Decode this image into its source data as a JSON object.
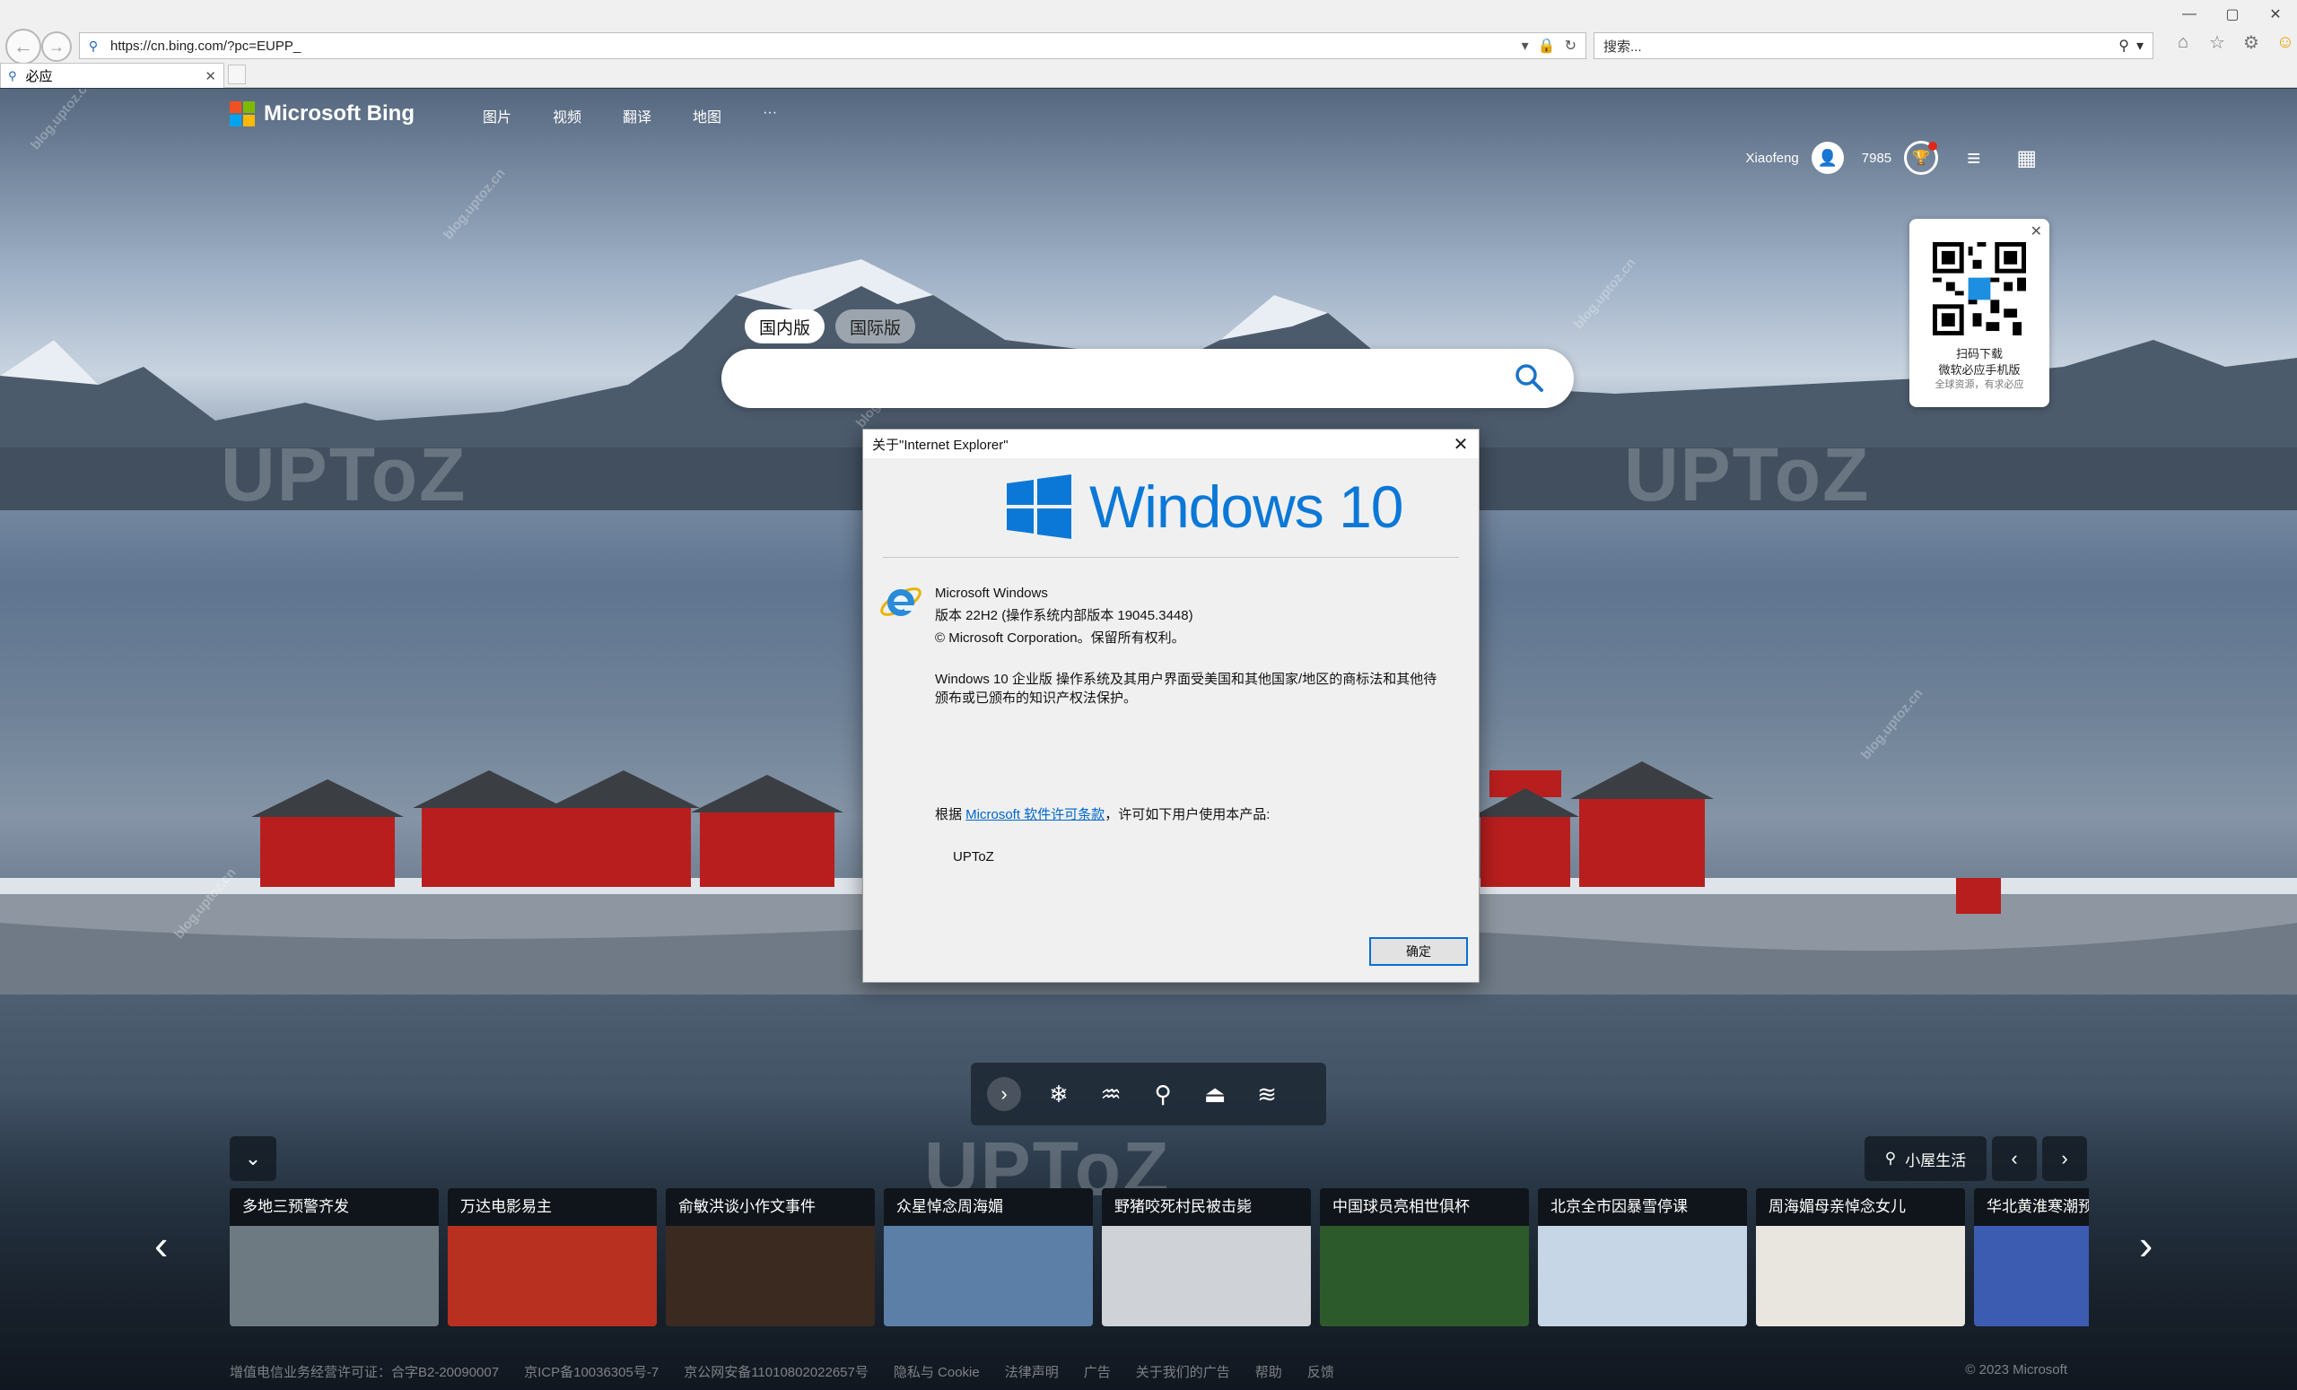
{
  "browser": {
    "url": "https://cn.bing.com/?pc=EUPP_",
    "search_placeholder": "搜索...",
    "tab_label": "必应",
    "window_buttons": [
      "—",
      "▢",
      "✕"
    ]
  },
  "bing": {
    "brand": "Microsoft Bing",
    "nav": [
      "图片",
      "视频",
      "翻译",
      "地图",
      "···"
    ],
    "user": "Xiaofeng",
    "points": "7985",
    "search_tabs": [
      "国内版",
      "国际版"
    ],
    "qr": {
      "line1": "扫码下载",
      "line2": "微软必应手机版",
      "line3": "全球资源，有求必应"
    },
    "location_label": "小屋生活",
    "news": [
      {
        "title": "多地三预警齐发",
        "color": "#6d7a82"
      },
      {
        "title": "万达电影易主",
        "color": "#b8301f"
      },
      {
        "title": "俞敏洪谈小作文事件",
        "color": "#3a2a20"
      },
      {
        "title": "众星悼念周海媚",
        "color": "#5c7fa8"
      },
      {
        "title": "野猪咬死村民被击毙",
        "color": "#cfd2d6"
      },
      {
        "title": "中国球员亮相世俱杯",
        "color": "#2d5a2a"
      },
      {
        "title": "北京全市因暴雪停课",
        "color": "#c7d6e6"
      },
      {
        "title": "周海媚母亲悼念女儿",
        "color": "#e9e6e0"
      },
      {
        "title": "华北黄淮寒潮预警",
        "color": "#3b5cb0"
      }
    ],
    "footer": [
      "增值电信业务经营许可证：合字B2-20090007",
      "京ICP备10036305号-7",
      "京公网安备11010802022657号",
      "隐私与 Cookie",
      "法律声明",
      "广告",
      "关于我们的广告",
      "帮助",
      "反馈"
    ],
    "copyright": "© 2023 Microsoft"
  },
  "dialog": {
    "title": "关于\"Internet Explorer\"",
    "brand": "Windows 10",
    "product": "Microsoft Windows",
    "version": "版本 22H2 (操作系统内部版本 19045.3448)",
    "copyright": "© Microsoft Corporation。保留所有权利。",
    "description": "Windows 10 企业版 操作系统及其用户界面受美国和其他国家/地区的商标法和其他待颁布或已颁布的知识产权法保护。",
    "license_prefix": "根据 ",
    "license_link": "Microsoft 软件许可条款",
    "license_suffix": "，许可如下用户使用本产品:",
    "licensee": "UPToZ",
    "ok": "确定"
  },
  "watermark": {
    "small": "blog.uptoz.cn",
    "big": "UPToZ"
  }
}
